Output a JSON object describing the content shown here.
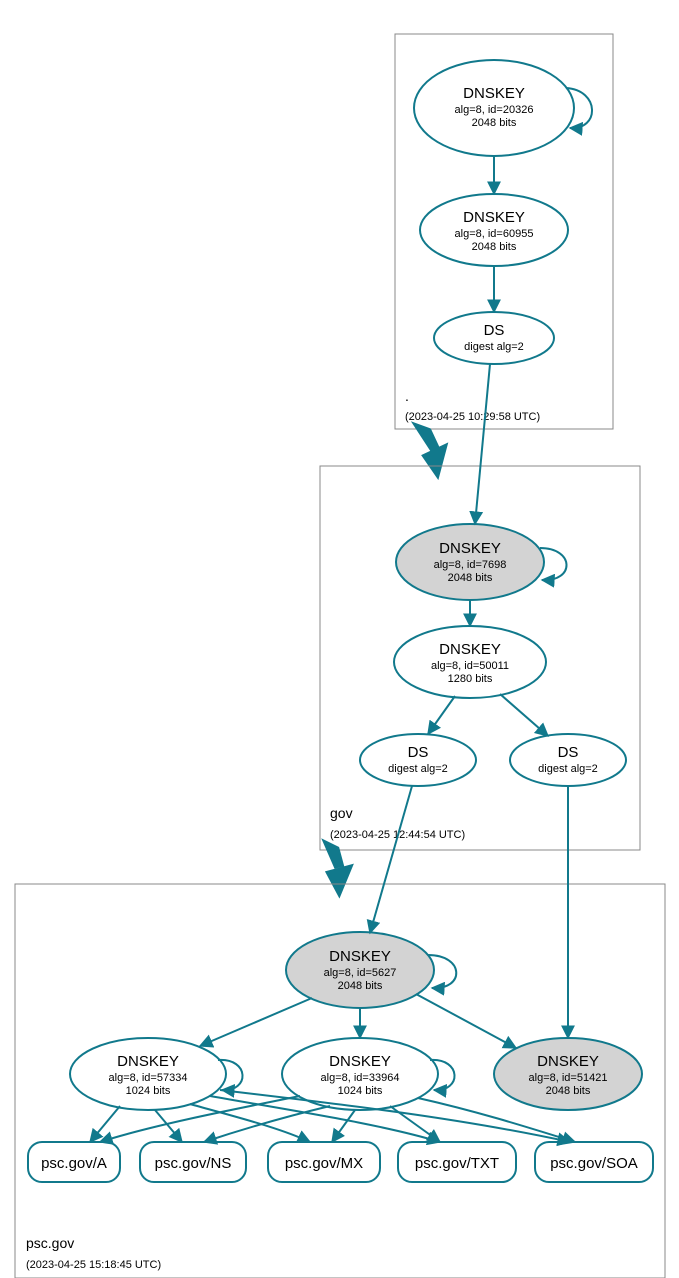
{
  "zones": {
    "root": {
      "name": ".",
      "timestamp": "(2023-04-25 10:29:58 UTC)"
    },
    "gov": {
      "name": "gov",
      "timestamp": "(2023-04-25 12:44:54 UTC)"
    },
    "psc": {
      "name": "psc.gov",
      "timestamp": "(2023-04-25 15:18:45 UTC)"
    }
  },
  "nodes": {
    "root_ksk": {
      "title": "DNSKEY",
      "line1": "alg=8, id=20326",
      "line2": "2048 bits"
    },
    "root_zsk": {
      "title": "DNSKEY",
      "line1": "alg=8, id=60955",
      "line2": "2048 bits"
    },
    "root_ds": {
      "title": "DS",
      "line1": "digest alg=2"
    },
    "gov_ksk": {
      "title": "DNSKEY",
      "line1": "alg=8, id=7698",
      "line2": "2048 bits"
    },
    "gov_zsk": {
      "title": "DNSKEY",
      "line1": "alg=8, id=50011",
      "line2": "1280 bits"
    },
    "gov_ds1": {
      "title": "DS",
      "line1": "digest alg=2"
    },
    "gov_ds2": {
      "title": "DS",
      "line1": "digest alg=2"
    },
    "psc_ksk": {
      "title": "DNSKEY",
      "line1": "alg=8, id=5627",
      "line2": "2048 bits"
    },
    "psc_zsk1": {
      "title": "DNSKEY",
      "line1": "alg=8, id=57334",
      "line2": "1024 bits"
    },
    "psc_zsk2": {
      "title": "DNSKEY",
      "line1": "alg=8, id=33964",
      "line2": "1024 bits"
    },
    "psc_key3": {
      "title": "DNSKEY",
      "line1": "alg=8, id=51421",
      "line2": "2048 bits"
    },
    "rr_a": {
      "label": "psc.gov/A"
    },
    "rr_ns": {
      "label": "psc.gov/NS"
    },
    "rr_mx": {
      "label": "psc.gov/MX"
    },
    "rr_txt": {
      "label": "psc.gov/TXT"
    },
    "rr_soa": {
      "label": "psc.gov/SOA"
    }
  }
}
